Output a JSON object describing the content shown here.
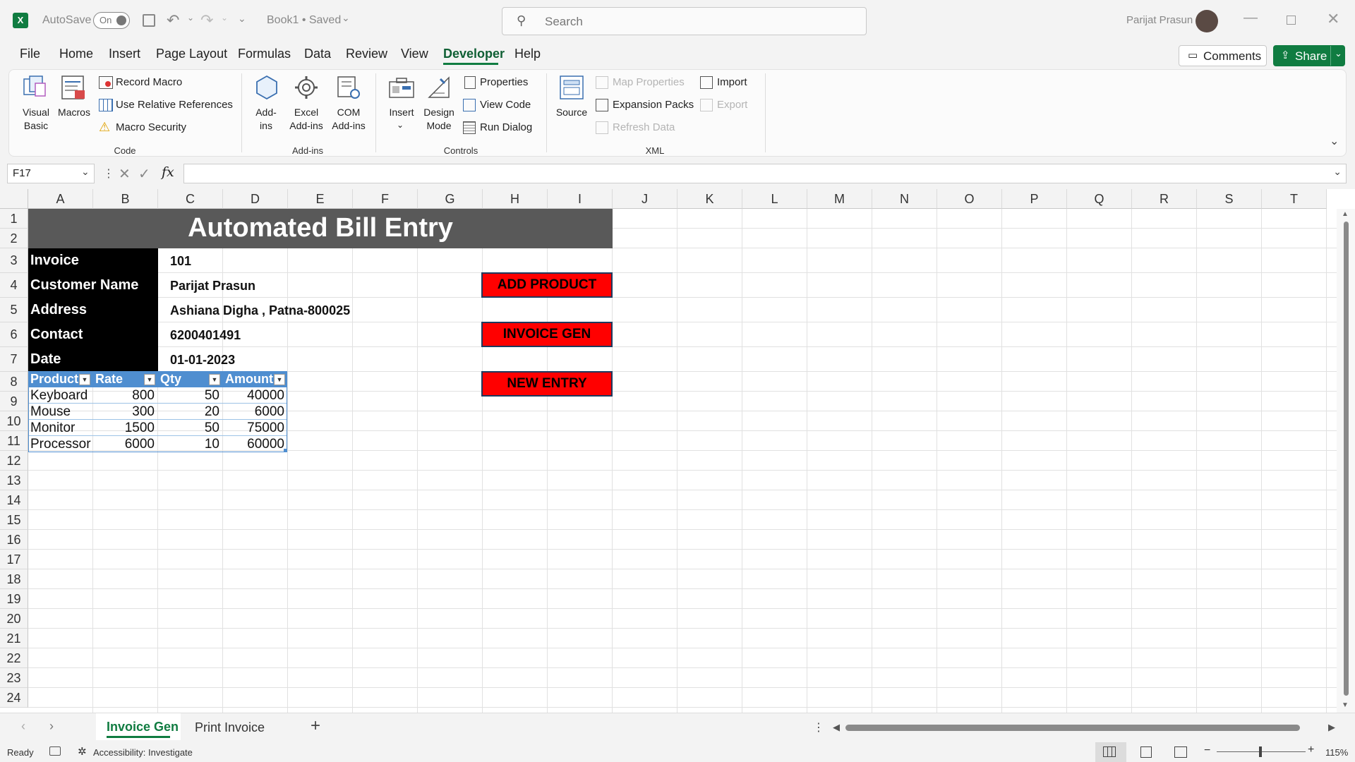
{
  "titlebar": {
    "autosave_label": "AutoSave",
    "autosave_state": "On",
    "doc_title": "Book1 • Saved",
    "search_placeholder": "Search",
    "user_name": "Parijat Prasun"
  },
  "menu": {
    "tabs": [
      "File",
      "Home",
      "Insert",
      "Page Layout",
      "Formulas",
      "Data",
      "Review",
      "View",
      "Developer",
      "Help"
    ],
    "active": "Developer",
    "comments_label": "Comments",
    "share_label": "Share"
  },
  "ribbon": {
    "code": {
      "visual_basic": "Visual Basic",
      "visual_basic_l1": "Visual",
      "visual_basic_l2": "Basic",
      "macros": "Macros",
      "record_macro": "Record Macro",
      "use_relative": "Use Relative References",
      "macro_security": "Macro Security",
      "group": "Code"
    },
    "addins": {
      "addins_l1": "Add-",
      "addins_l2": "ins",
      "excel_l1": "Excel",
      "excel_l2": "Add-ins",
      "com_l1": "COM",
      "com_l2": "Add-ins",
      "group": "Add-ins"
    },
    "controls": {
      "insert": "Insert",
      "design_l1": "Design",
      "design_l2": "Mode",
      "properties": "Properties",
      "view_code": "View Code",
      "run_dialog": "Run Dialog",
      "group": "Controls"
    },
    "xml": {
      "source": "Source",
      "map_properties": "Map Properties",
      "expansion_packs": "Expansion Packs",
      "refresh_data": "Refresh Data",
      "import": "Import",
      "export": "Export",
      "group": "XML"
    }
  },
  "formula_bar": {
    "name_box": "F17",
    "fx": "fx",
    "formula": ""
  },
  "sheet": {
    "columns": [
      "A",
      "B",
      "C",
      "D",
      "E",
      "F",
      "G",
      "H",
      "I",
      "J",
      "K",
      "L",
      "M",
      "N",
      "O",
      "P",
      "Q",
      "R",
      "S",
      "T"
    ],
    "rows": [
      "1",
      "2",
      "3",
      "4",
      "5",
      "6",
      "7",
      "8",
      "9",
      "10",
      "11",
      "12",
      "13",
      "14",
      "15",
      "16",
      "17",
      "18",
      "19",
      "20",
      "21",
      "22",
      "23",
      "24"
    ],
    "title": "Automated Bill Entry",
    "fields": [
      {
        "label": "Invoice",
        "value": "101"
      },
      {
        "label": "Customer Name",
        "value": "Parijat Prasun"
      },
      {
        "label": "Address",
        "value": "Ashiana Digha , Patna-800025"
      },
      {
        "label": "Contact",
        "value": "6200401491"
      },
      {
        "label": "Date",
        "value": "01-01-2023"
      }
    ],
    "table": {
      "headers": [
        "Product",
        "Rate",
        "Qty",
        "Amount"
      ],
      "rows": [
        [
          "Keyboard",
          "800",
          "50",
          "40000"
        ],
        [
          "Mouse",
          "300",
          "20",
          "6000"
        ],
        [
          "Monitor",
          "1500",
          "50",
          "75000"
        ],
        [
          "Processor",
          "6000",
          "10",
          "60000"
        ]
      ]
    },
    "buttons": [
      "ADD PRODUCT",
      "INVOICE GEN",
      "NEW ENTRY"
    ]
  },
  "sheet_tabs": [
    "Invoice Gen",
    "Print Invoice"
  ],
  "active_sheet": "Invoice Gen",
  "status": {
    "ready": "Ready",
    "accessibility": "Accessibility: Investigate",
    "zoom": "115%"
  }
}
